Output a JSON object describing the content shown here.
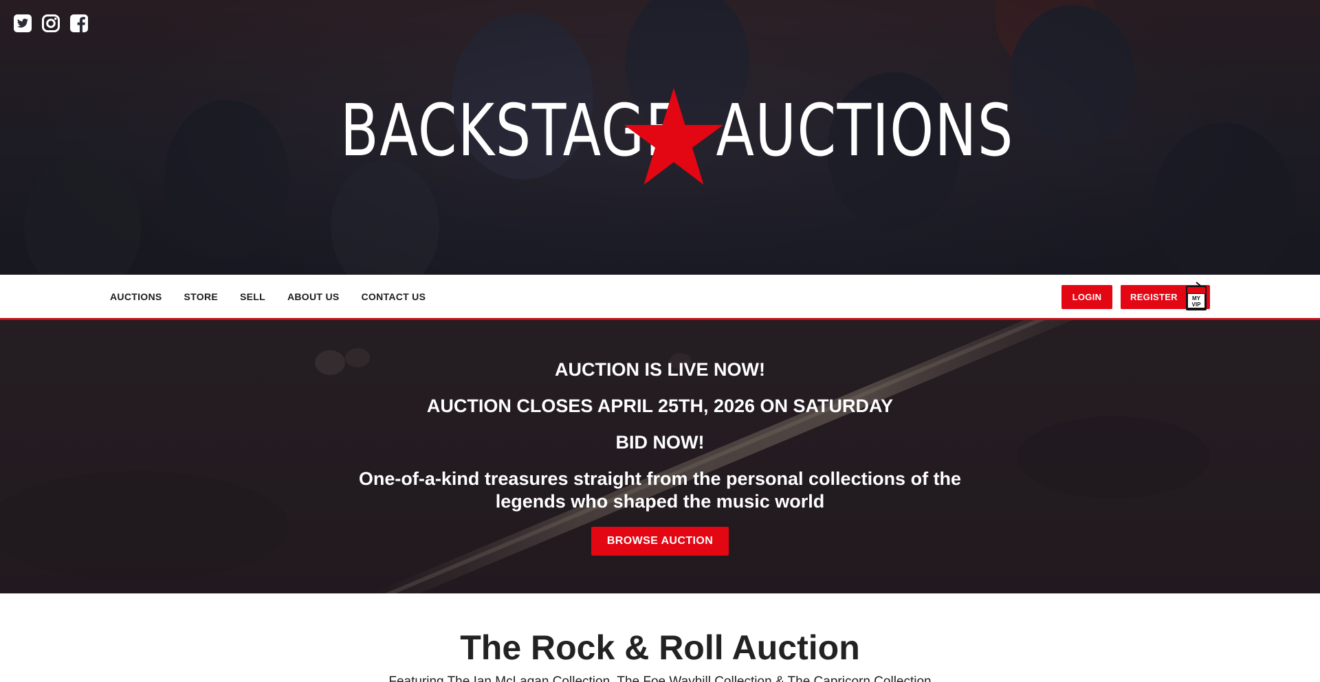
{
  "header": {
    "social": [
      {
        "icon": "twitter-icon"
      },
      {
        "icon": "instagram-icon"
      },
      {
        "icon": "facebook-icon"
      }
    ],
    "logo": {
      "part1": "BACKSTAGE",
      "part2": "AUCTIONS",
      "star_color": "#e30613"
    }
  },
  "nav": {
    "links": [
      "AUCTIONS",
      "STORE",
      "SELL",
      "ABOUT US",
      "CONTACT US"
    ],
    "login_label": "LOGIN",
    "register_label": "REGISTER",
    "vip_badge_text": "MY VIP"
  },
  "banner": {
    "line1": "AUCTION IS LIVE NOW!",
    "line2": "AUCTION CLOSES APRIL 25TH, 2026 ON SATURDAY",
    "line3": "BID NOW!",
    "description": "One-of-a-kind treasures straight from the personal collections of the legends who shaped the music world",
    "button_label": "BROWSE AUCTION"
  },
  "main": {
    "title": "The Rock & Roll Auction",
    "subtitle": "Featuring The Ian McLagan Collection, The Foe Wayhill Collection & The Capricorn Collection"
  },
  "colors": {
    "accent": "#e30613",
    "nav_border": "#c8101a",
    "text_dark": "#1b1b1b"
  }
}
